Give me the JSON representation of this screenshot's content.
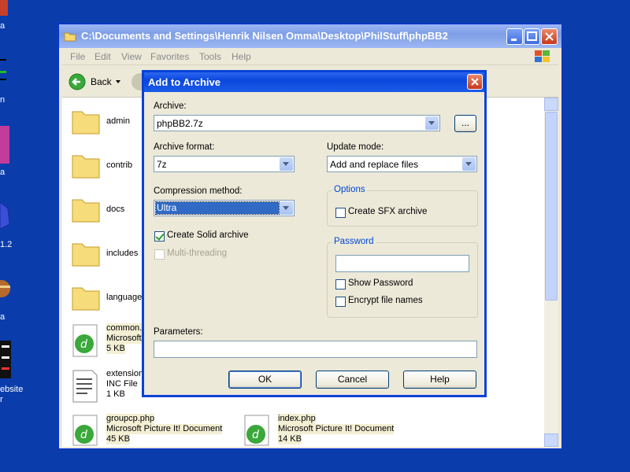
{
  "desktop": {
    "labels": [
      "a",
      "n",
      "a",
      "1.2",
      "a",
      "ebsite",
      "r"
    ]
  },
  "explorer": {
    "title": "C:\\Documents and Settings\\Henrik Nilsen Omma\\Desktop\\PhilStuff\\phpBB2",
    "menu": [
      "File",
      "Edit",
      "View",
      "Favorites",
      "Tools",
      "Help"
    ],
    "back_label": "Back",
    "files": [
      {
        "name": "admin"
      },
      {
        "name": "contrib"
      },
      {
        "name": "docs"
      },
      {
        "name": "includes"
      },
      {
        "name": "language"
      },
      {
        "name": "common.",
        "type": "Microsoft",
        "size": "5 KB"
      },
      {
        "name": "extension",
        "type": "INC File",
        "size": "1 KB"
      },
      {
        "name": "groupcp.php",
        "type": "Microsoft Picture It! Document",
        "size": "45 KB"
      },
      {
        "name": "index.php",
        "type": "Microsoft Picture It! Document",
        "size": "14 KB"
      }
    ]
  },
  "dialog": {
    "title": "Add to Archive",
    "archive_label": "Archive:",
    "archive_value": "phpBB2.7z",
    "browse_label": "...",
    "format_label": "Archive format:",
    "format_value": "7z",
    "update_label": "Update mode:",
    "update_value": "Add and replace files",
    "method_label": "Compression method:",
    "method_value": "Ultra",
    "solid_label": "Create Solid archive",
    "solid_checked": true,
    "multithread_label": "Multi-threading",
    "options_title": "Options",
    "sfx_label": "Create SFX archive",
    "password_title": "Password",
    "show_password_label": "Show Password",
    "encrypt_label": "Encrypt file names",
    "parameters_label": "Parameters:",
    "ok_label": "OK",
    "cancel_label": "Cancel",
    "help_label": "Help"
  },
  "colors": {
    "desktop": "#0a3dab",
    "dialog_border": "#0842d9",
    "selection": "#316ac5"
  }
}
